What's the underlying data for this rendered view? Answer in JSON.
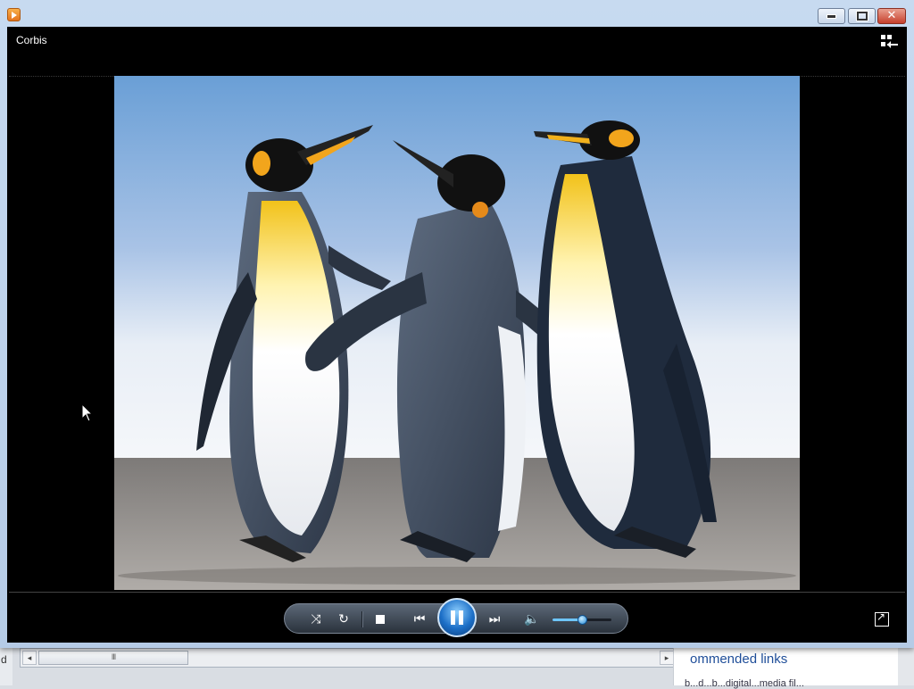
{
  "player": {
    "now_playing_title": "Corbis",
    "volume_level": 0.5
  },
  "background": {
    "left_strip_text": "d",
    "panel_heading": "ommended links",
    "panel_subtext": "b...d...b...digital...media fil..."
  },
  "icons": {
    "app": "media-player-icon",
    "switch_to_library": "switch-to-library-icon",
    "fullscreen": "fullscreen-icon",
    "shuffle": "shuffle-icon",
    "repeat": "repeat-icon",
    "stop": "stop-icon",
    "previous": "previous-icon",
    "play_pause": "pause-icon",
    "next": "next-icon",
    "mute": "speaker-icon"
  },
  "colors": {
    "titlebar": "#c7daf0",
    "play_button": "#1c6fc7",
    "close_button": "#c7402d",
    "volume_fill": "#6ec6ff"
  }
}
